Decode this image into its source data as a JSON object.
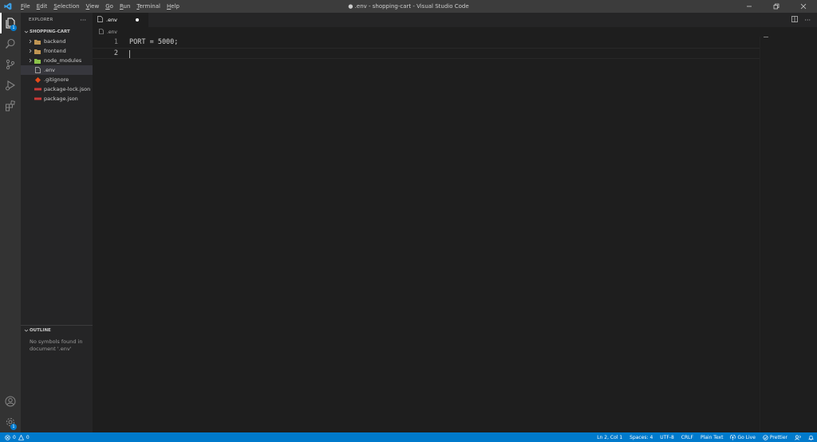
{
  "window": {
    "title": "● .env - shopping-cart - Visual Studio Code"
  },
  "menu": [
    {
      "first": "F",
      "rest": "ile"
    },
    {
      "first": "E",
      "rest": "dit"
    },
    {
      "first": "S",
      "rest": "election"
    },
    {
      "first": "V",
      "rest": "iew"
    },
    {
      "first": "G",
      "rest": "o"
    },
    {
      "first": "R",
      "rest": "un"
    },
    {
      "first": "T",
      "rest": "erminal"
    },
    {
      "first": "H",
      "rest": "elp"
    }
  ],
  "activity": {
    "explorer_badge": "1",
    "settings_badge": "1"
  },
  "sidebar": {
    "title": "EXPLORER",
    "more": "···",
    "folder": "SHOPPING-CART",
    "items": [
      {
        "label": "backend",
        "icon": "folder-icon"
      },
      {
        "label": "frontend",
        "icon": "folder-icon"
      },
      {
        "label": "node_modules",
        "icon": "node-folder-icon"
      },
      {
        "label": ".env",
        "icon": "file-icon"
      },
      {
        "label": ".gitignore",
        "icon": "git-icon"
      },
      {
        "label": "package-lock.json",
        "icon": "npm-icon"
      },
      {
        "label": "package.json",
        "icon": "npm-icon"
      }
    ],
    "outline_title": "OUTLINE",
    "outline_msg": "No symbols found in document '.env'"
  },
  "tabs": [
    {
      "label": ".env",
      "modified": true
    }
  ],
  "breadcrumb": ".env",
  "editor": {
    "lines": [
      {
        "num": "1",
        "text": "PORT = 5000;"
      },
      {
        "num": "2",
        "text": ""
      }
    ]
  },
  "status": {
    "errors": "0",
    "warnings": "0",
    "position": "Ln 2, Col 1",
    "spaces": "Spaces: 4",
    "encoding": "UTF-8",
    "eol": "CRLF",
    "language": "Plain Text",
    "golive": "Go Live",
    "prettier": "Prettier"
  },
  "colors": {
    "accent": "#007acc",
    "titlebar": "#3c3c3c",
    "activitybar": "#333333",
    "sidebar": "#252526",
    "editor": "#1e1e1e",
    "folder": "#c09553",
    "node_folder": "#8bc34a",
    "git": "#e64a19",
    "npm": "#cb3837"
  }
}
